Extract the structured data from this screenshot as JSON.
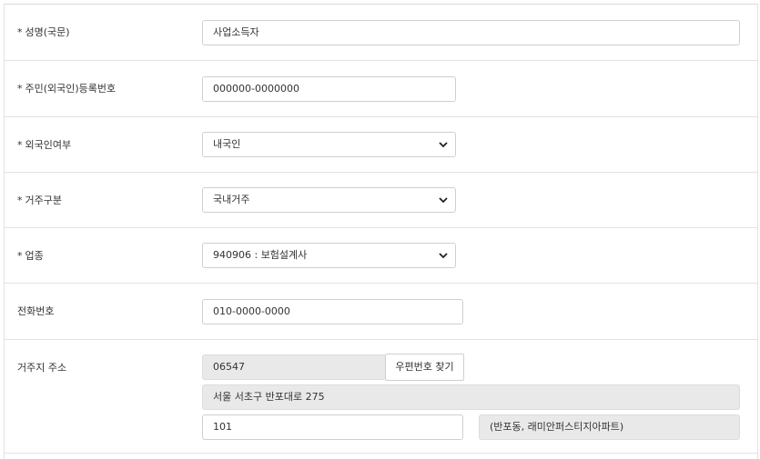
{
  "form": {
    "name": {
      "label": "성명(국문)",
      "required_mark": "*",
      "value": "사업소득자"
    },
    "reg_no": {
      "label": "주민(외국인)등록번호",
      "required_mark": "*",
      "value": "000000-0000000"
    },
    "foreigner": {
      "label": "외국인여부",
      "required_mark": "*",
      "value": "내국인",
      "icon": "chevron-down-icon"
    },
    "residence": {
      "label": "거주구분",
      "required_mark": "*",
      "value": "국내거주",
      "icon": "chevron-down-icon"
    },
    "industry": {
      "label": "업종",
      "required_mark": "*",
      "value": "940906 : 보험설계사",
      "icon": "chevron-down-icon"
    },
    "phone": {
      "label": "전화번호",
      "value": "010-0000-0000"
    },
    "address": {
      "label": "거주지 주소",
      "postal_code": "06547",
      "find_button": "우편번호 찾기",
      "road_address": "서울 서초구 반포대로 275",
      "detail": "101",
      "extra": "(반포동, 래미안퍼스티지아파트)"
    }
  }
}
